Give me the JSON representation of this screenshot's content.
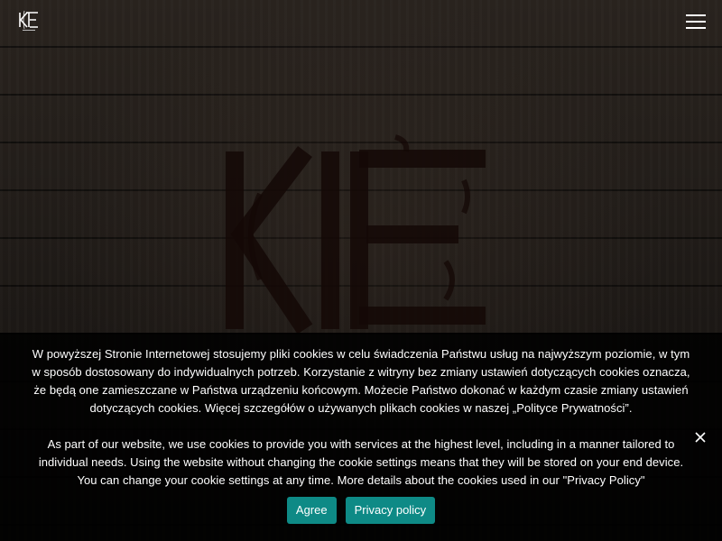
{
  "header": {
    "logo_icon": "kte-logo-icon",
    "menu_icon": "hamburger-menu-icon"
  },
  "hero": {
    "mark_icon": "kte-engraved-logo-icon"
  },
  "cookie_notice": {
    "text_pl": "W powyższej Stronie Internetowej stosujemy pliki cookies w celu świadczenia Państwu usług na najwyższym poziomie, w tym w sposób dostosowany do indywidualnych potrzeb. Korzystanie z witryny bez zmiany ustawień dotyczących cookies oznacza, że będą one zamieszczane w Państwa urządzeniu końcowym. Możecie Państwo dokonać w każdym czasie zmiany ustawień dotyczących cookies. Więcej szczegółów o używanych plikach cookies w naszej „Polityce Prywatności”.",
    "text_en": "As part of our website, we use cookies to provide you with services at the highest level, including in a manner tailored to individual needs. Using the website without changing the cookie settings means that they will be stored on your end device. You can change your cookie settings at any time. More details about the cookies used in our \"Privacy Policy\"",
    "agree_label": "Agree",
    "privacy_label": "Privacy policy",
    "close_icon": "close-icon",
    "accent_color": "#0e8a86"
  }
}
